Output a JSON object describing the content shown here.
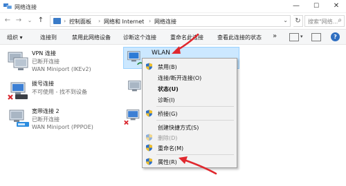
{
  "window": {
    "title": "网络连接",
    "controls": {
      "minimize": "—",
      "maximize": "☐",
      "close": "✕"
    }
  },
  "nav": {
    "back": "←",
    "forward": "→",
    "recent": "⌄",
    "up": "↑"
  },
  "address": {
    "crumbs": [
      "控制面板",
      "网络和 Internet",
      "网络连接"
    ],
    "separator": "›",
    "dropdown": "⌄",
    "refresh": "↻"
  },
  "search": {
    "placeholder": "搜索\"网络...",
    "icon": "⌕"
  },
  "commands": {
    "organize": "组织 ▾",
    "connect_to": "连接到",
    "disable_device": "禁用此网络设备",
    "diagnose": "诊断这个连接",
    "rename": "重命名此连接",
    "view_status": "查看此连接的状态",
    "more": "»",
    "help": "?"
  },
  "connections": [
    {
      "name": "VPN 连接",
      "status": "已断开连接",
      "device": "WAN Miniport (IKEv2)",
      "icon": "vpn-icon"
    },
    {
      "name": "拨号连接",
      "status": "不可使用 - 找不到设备",
      "device": "",
      "icon": "dialup-icon"
    },
    {
      "name": "宽带连接 2",
      "status": "已断开连接",
      "device": "WAN Miniport (PPPOE)",
      "icon": "broadband-icon"
    },
    {
      "name": "WLAN",
      "status": "",
      "device": "",
      "icon": "wlan-icon"
    }
  ],
  "context_menu": [
    {
      "label": "禁用(B)",
      "shield": true,
      "enabled": true,
      "bold": false
    },
    {
      "label": "连接/断开连接(O)",
      "shield": false,
      "enabled": true,
      "bold": false
    },
    {
      "label": "状态(U)",
      "shield": false,
      "enabled": true,
      "bold": true
    },
    {
      "label": "诊断(I)",
      "shield": false,
      "enabled": true,
      "bold": false
    },
    {
      "label": "桥接(G)",
      "shield": true,
      "enabled": true,
      "bold": false
    },
    {
      "label": "创建快捷方式(S)",
      "shield": false,
      "enabled": true,
      "bold": false
    },
    {
      "label": "删除(D)",
      "shield": true,
      "enabled": false,
      "bold": false
    },
    {
      "label": "重命名(M)",
      "shield": true,
      "enabled": true,
      "bold": false
    },
    {
      "label": "属性(R)",
      "shield": true,
      "enabled": true,
      "bold": false
    }
  ],
  "colors": {
    "selection": "#cce8ff",
    "annotation_arrow": "#e0282e",
    "error_x": "#d9282f",
    "monitor_blue": "#2e7bd6"
  }
}
